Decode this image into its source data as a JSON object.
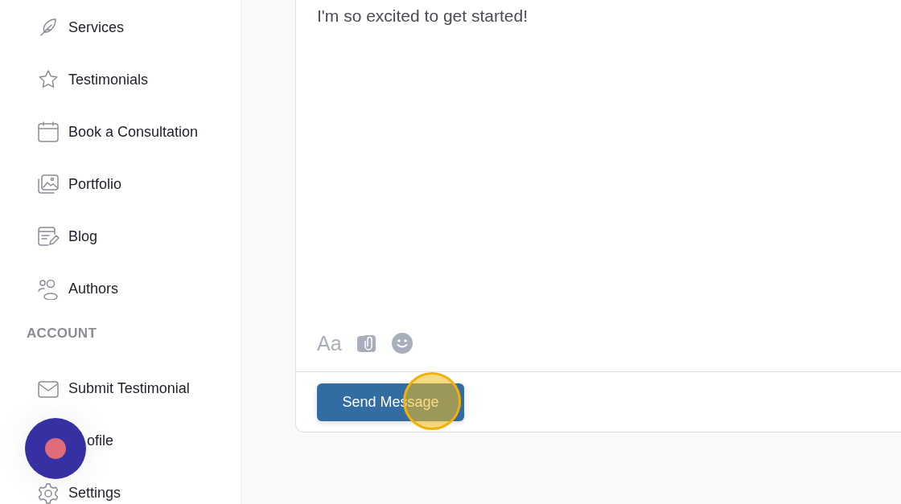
{
  "sidebar": {
    "items": [
      {
        "kind": "feather",
        "label": "Services"
      },
      {
        "kind": "star",
        "label": "Testimonials"
      },
      {
        "kind": "calendar",
        "label": "Book a Consultation"
      },
      {
        "kind": "images",
        "label": "Portfolio"
      },
      {
        "kind": "blog",
        "label": "Blog"
      },
      {
        "kind": "people",
        "label": "Authors"
      }
    ],
    "section": "ACCOUNT",
    "account_items": [
      {
        "kind": "mail",
        "label": "Submit Testimonial"
      },
      {
        "kind": "none",
        "label": "ofile"
      },
      {
        "kind": "gear",
        "label": "Settings"
      }
    ]
  },
  "message": {
    "value": "I'm so excited to get started!",
    "format_label": "Aa",
    "send_button": "Send Message"
  }
}
